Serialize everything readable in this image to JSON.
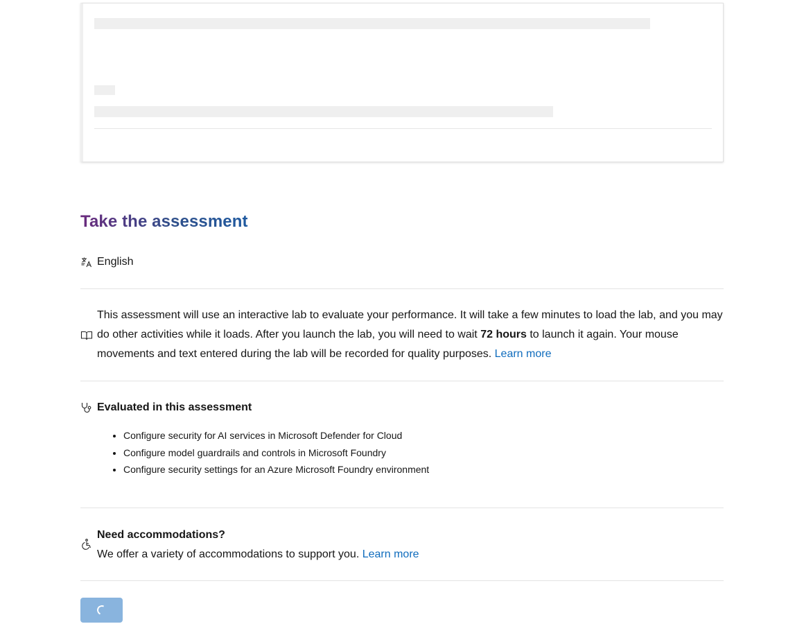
{
  "assessment": {
    "title": "Take the assessment",
    "language": "English",
    "description": {
      "part1": "This assessment will use an interactive lab to evaluate your performance. It will take a few minutes to load the lab, and you may do other activities while it loads. After you launch the lab, you will need to wait ",
      "wait_time": "72 hours",
      "part2": " to launch it again. Your mouse movements and text entered during the lab will be recorded for quality purposes. ",
      "learn_more": "Learn more"
    },
    "evaluated": {
      "heading": "Evaluated in this assessment",
      "skills": [
        "Configure security for AI services in Microsoft Defender for Cloud",
        "Configure model guardrails and controls in Microsoft Foundry",
        "Configure security settings for an Azure Microsoft Foundry environment"
      ]
    },
    "accommodations": {
      "heading": "Need accommodations?",
      "text": "We offer a variety of accommodations to support you. ",
      "learn_more": "Learn more"
    },
    "launch_button": {
      "state": "loading",
      "icon": "spinner-icon"
    }
  },
  "colors": {
    "link": "#0f6cbd",
    "button_disabled": "#89b4de",
    "title_gradient_start": "#6b2a7d",
    "title_gradient_end": "#1f5aa0",
    "skeleton": "#efefef"
  },
  "icons": {
    "language": "translate-icon",
    "description": "book-icon",
    "evaluated": "stethoscope-icon",
    "accommodations": "accessibility-icon"
  }
}
